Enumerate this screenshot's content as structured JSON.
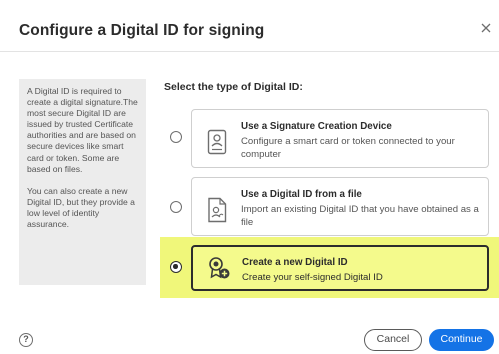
{
  "dialog": {
    "title": "Configure a Digital ID for signing",
    "close_icon": "close-icon"
  },
  "info": {
    "paragraph1": "A Digital ID is required to create a digital signature.The most secure Digital ID are issued by trusted Certificate authorities and are based on secure devices like smart card or token. Some are based on files.",
    "paragraph2": "You can also create a new Digital ID, but they provide a low level of identity assurance."
  },
  "selection": {
    "heading": "Select the type of Digital ID:",
    "options": [
      {
        "title": "Use a Signature Creation Device",
        "description": "Configure a smart card or token connected to your computer",
        "icon": "id-card-icon",
        "selected": false
      },
      {
        "title": "Use a Digital ID from a file",
        "description": "Import an existing Digital ID that you have obtained as a file",
        "icon": "file-certificate-icon",
        "selected": false
      },
      {
        "title": "Create a new Digital ID",
        "description": "Create your self-signed Digital ID",
        "icon": "new-digital-id-icon",
        "selected": true
      }
    ]
  },
  "footer": {
    "help_label": "?",
    "cancel_label": "Cancel",
    "continue_label": "Continue"
  },
  "colors": {
    "accent": "#1473e6",
    "highlight": "#f0f77a",
    "panel_bg": "#ececec"
  }
}
